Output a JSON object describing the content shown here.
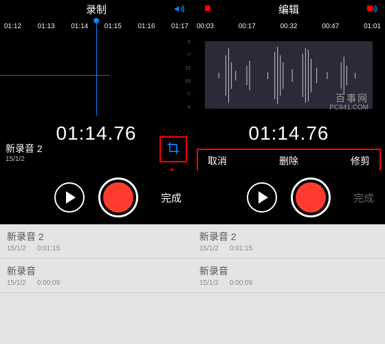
{
  "left": {
    "header": {
      "title": "录制"
    },
    "timeline": [
      "01:12",
      "01:13",
      "01:14",
      "01:15",
      "01:16",
      "01:17"
    ],
    "scale": [
      "0",
      "-7",
      "-15",
      "-15",
      "-7",
      "0"
    ],
    "elapsed": "01:14.76",
    "recording": {
      "name": "新录音 2",
      "date": "15/1/2"
    },
    "done_label": "完成",
    "list": [
      {
        "name": "新录音 2",
        "date": "15/1/2",
        "duration": "0:01:15"
      },
      {
        "name": "新录音",
        "date": "15/1/2",
        "duration": "0:00:09"
      }
    ]
  },
  "right": {
    "header": {
      "title": "编辑"
    },
    "timeline": [
      "00:03",
      "00:17",
      "00:32",
      "00:47",
      "01:01"
    ],
    "watermark": {
      "line1": "百事网",
      "line2": "PC841.COM"
    },
    "elapsed": "01:14.76",
    "actions": {
      "cancel": "取消",
      "delete": "删除",
      "trim": "修剪"
    },
    "done_label": "完成",
    "list": [
      {
        "name": "新录音 2",
        "date": "15/1/2",
        "duration": "0:01:15"
      },
      {
        "name": "新录音",
        "date": "15/1/2",
        "duration": "0:00:09"
      }
    ]
  },
  "colors": {
    "accent": "#0a84ff",
    "record": "#ff3b30"
  }
}
